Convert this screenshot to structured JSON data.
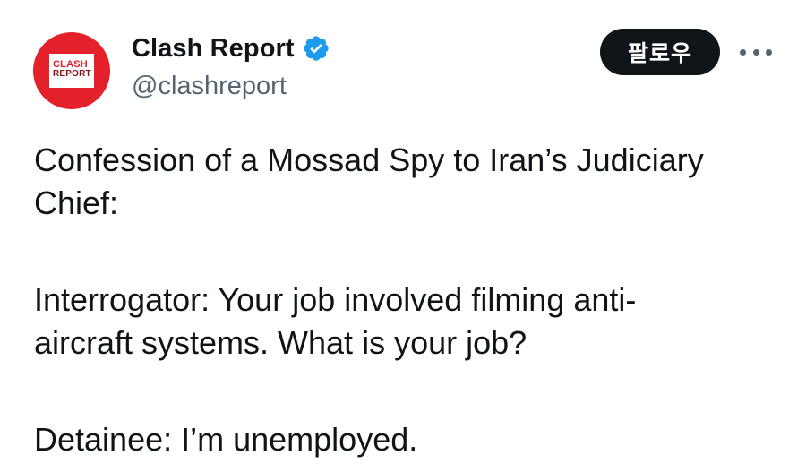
{
  "author": {
    "display_name": "Clash Report",
    "handle": "@clashreport",
    "avatar_logo": {
      "top": "CLASH",
      "bottom": "REPORT"
    },
    "verified": true
  },
  "actions": {
    "follow_label": "팔로우",
    "more_icon": "more-horizontal-icon"
  },
  "tweet": {
    "paragraphs": [
      [
        "Confession of a Mossad Spy to Iran’s Judiciary",
        "Chief:"
      ],
      [
        "Interrogator: Your job involved filming anti-",
        "aircraft systems. What is your job?"
      ],
      [
        "Detainee: I’m unemployed."
      ]
    ]
  },
  "colors": {
    "text_primary": "#0f1419",
    "text_secondary": "#536471",
    "verified_blue": "#1d9bf0",
    "avatar_red": "#e4212b",
    "button_bg": "#0f1419"
  }
}
